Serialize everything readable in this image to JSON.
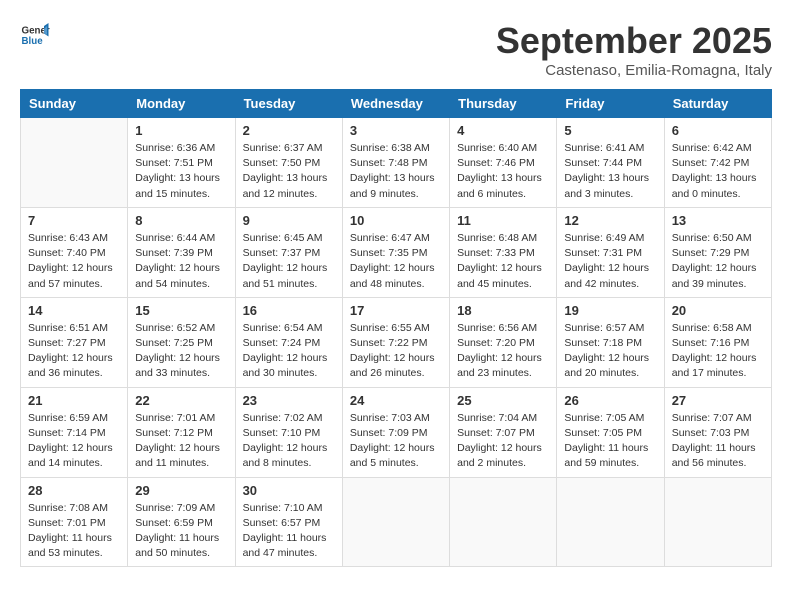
{
  "header": {
    "logo_general": "General",
    "logo_blue": "Blue",
    "month": "September 2025",
    "location": "Castenaso, Emilia-Romagna, Italy"
  },
  "weekdays": [
    "Sunday",
    "Monday",
    "Tuesday",
    "Wednesday",
    "Thursday",
    "Friday",
    "Saturday"
  ],
  "weeks": [
    [
      {
        "day": "",
        "info": ""
      },
      {
        "day": "1",
        "info": "Sunrise: 6:36 AM\nSunset: 7:51 PM\nDaylight: 13 hours\nand 15 minutes."
      },
      {
        "day": "2",
        "info": "Sunrise: 6:37 AM\nSunset: 7:50 PM\nDaylight: 13 hours\nand 12 minutes."
      },
      {
        "day": "3",
        "info": "Sunrise: 6:38 AM\nSunset: 7:48 PM\nDaylight: 13 hours\nand 9 minutes."
      },
      {
        "day": "4",
        "info": "Sunrise: 6:40 AM\nSunset: 7:46 PM\nDaylight: 13 hours\nand 6 minutes."
      },
      {
        "day": "5",
        "info": "Sunrise: 6:41 AM\nSunset: 7:44 PM\nDaylight: 13 hours\nand 3 minutes."
      },
      {
        "day": "6",
        "info": "Sunrise: 6:42 AM\nSunset: 7:42 PM\nDaylight: 13 hours\nand 0 minutes."
      }
    ],
    [
      {
        "day": "7",
        "info": "Sunrise: 6:43 AM\nSunset: 7:40 PM\nDaylight: 12 hours\nand 57 minutes."
      },
      {
        "day": "8",
        "info": "Sunrise: 6:44 AM\nSunset: 7:39 PM\nDaylight: 12 hours\nand 54 minutes."
      },
      {
        "day": "9",
        "info": "Sunrise: 6:45 AM\nSunset: 7:37 PM\nDaylight: 12 hours\nand 51 minutes."
      },
      {
        "day": "10",
        "info": "Sunrise: 6:47 AM\nSunset: 7:35 PM\nDaylight: 12 hours\nand 48 minutes."
      },
      {
        "day": "11",
        "info": "Sunrise: 6:48 AM\nSunset: 7:33 PM\nDaylight: 12 hours\nand 45 minutes."
      },
      {
        "day": "12",
        "info": "Sunrise: 6:49 AM\nSunset: 7:31 PM\nDaylight: 12 hours\nand 42 minutes."
      },
      {
        "day": "13",
        "info": "Sunrise: 6:50 AM\nSunset: 7:29 PM\nDaylight: 12 hours\nand 39 minutes."
      }
    ],
    [
      {
        "day": "14",
        "info": "Sunrise: 6:51 AM\nSunset: 7:27 PM\nDaylight: 12 hours\nand 36 minutes."
      },
      {
        "day": "15",
        "info": "Sunrise: 6:52 AM\nSunset: 7:25 PM\nDaylight: 12 hours\nand 33 minutes."
      },
      {
        "day": "16",
        "info": "Sunrise: 6:54 AM\nSunset: 7:24 PM\nDaylight: 12 hours\nand 30 minutes."
      },
      {
        "day": "17",
        "info": "Sunrise: 6:55 AM\nSunset: 7:22 PM\nDaylight: 12 hours\nand 26 minutes."
      },
      {
        "day": "18",
        "info": "Sunrise: 6:56 AM\nSunset: 7:20 PM\nDaylight: 12 hours\nand 23 minutes."
      },
      {
        "day": "19",
        "info": "Sunrise: 6:57 AM\nSunset: 7:18 PM\nDaylight: 12 hours\nand 20 minutes."
      },
      {
        "day": "20",
        "info": "Sunrise: 6:58 AM\nSunset: 7:16 PM\nDaylight: 12 hours\nand 17 minutes."
      }
    ],
    [
      {
        "day": "21",
        "info": "Sunrise: 6:59 AM\nSunset: 7:14 PM\nDaylight: 12 hours\nand 14 minutes."
      },
      {
        "day": "22",
        "info": "Sunrise: 7:01 AM\nSunset: 7:12 PM\nDaylight: 12 hours\nand 11 minutes."
      },
      {
        "day": "23",
        "info": "Sunrise: 7:02 AM\nSunset: 7:10 PM\nDaylight: 12 hours\nand 8 minutes."
      },
      {
        "day": "24",
        "info": "Sunrise: 7:03 AM\nSunset: 7:09 PM\nDaylight: 12 hours\nand 5 minutes."
      },
      {
        "day": "25",
        "info": "Sunrise: 7:04 AM\nSunset: 7:07 PM\nDaylight: 12 hours\nand 2 minutes."
      },
      {
        "day": "26",
        "info": "Sunrise: 7:05 AM\nSunset: 7:05 PM\nDaylight: 11 hours\nand 59 minutes."
      },
      {
        "day": "27",
        "info": "Sunrise: 7:07 AM\nSunset: 7:03 PM\nDaylight: 11 hours\nand 56 minutes."
      }
    ],
    [
      {
        "day": "28",
        "info": "Sunrise: 7:08 AM\nSunset: 7:01 PM\nDaylight: 11 hours\nand 53 minutes."
      },
      {
        "day": "29",
        "info": "Sunrise: 7:09 AM\nSunset: 6:59 PM\nDaylight: 11 hours\nand 50 minutes."
      },
      {
        "day": "30",
        "info": "Sunrise: 7:10 AM\nSunset: 6:57 PM\nDaylight: 11 hours\nand 47 minutes."
      },
      {
        "day": "",
        "info": ""
      },
      {
        "day": "",
        "info": ""
      },
      {
        "day": "",
        "info": ""
      },
      {
        "day": "",
        "info": ""
      }
    ]
  ]
}
